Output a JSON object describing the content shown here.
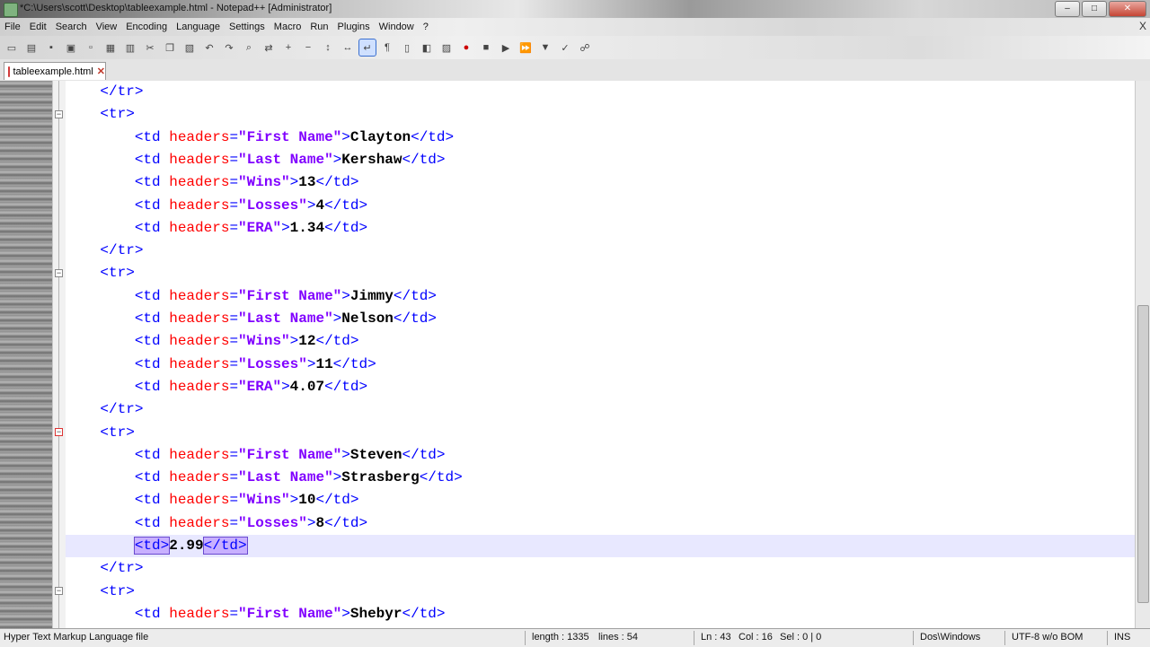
{
  "window": {
    "title": "*C:\\Users\\scott\\Desktop\\tableexample.html - Notepad++ [Administrator]",
    "controls": [
      "–",
      "□",
      "✕"
    ]
  },
  "menubar": {
    "items": [
      "File",
      "Edit",
      "Search",
      "View",
      "Encoding",
      "Language",
      "Settings",
      "Macro",
      "Run",
      "Plugins",
      "Window",
      "?"
    ],
    "close_label": "X"
  },
  "toolbar": {
    "buttons": [
      "new-icon",
      "open-icon",
      "save-icon",
      "save-all-icon",
      "close-icon",
      "close-all-icon",
      "print-icon",
      "cut-icon",
      "copy-icon",
      "paste-icon",
      "undo-icon",
      "redo-icon",
      "find-icon",
      "replace-icon",
      "zoom-in-icon",
      "zoom-out-icon",
      "sync-v-icon",
      "sync-h-icon",
      "wrap-icon",
      "all-chars-icon",
      "indent-guide-icon",
      "udl-icon",
      "doc-map-icon",
      "record-icon",
      "stop-icon",
      "play-icon",
      "play-multi-icon",
      "save-macro-icon",
      "spell-icon",
      "launch-icon"
    ]
  },
  "tabs": [
    {
      "label": "tableexample.html",
      "close": "✕"
    }
  ],
  "editor": {
    "first_line": [
      {
        "t": "    "
      },
      {
        "c": "tag",
        "t": "</tr>"
      }
    ],
    "lines": [
      [
        {
          "t": "    "
        },
        {
          "c": "tag",
          "t": "</tr>"
        }
      ],
      [
        {
          "t": "    "
        },
        {
          "c": "tag",
          "t": "<tr>"
        }
      ],
      [
        {
          "t": "        "
        },
        {
          "c": "tag",
          "t": "<td "
        },
        {
          "c": "attr",
          "t": "headers"
        },
        {
          "c": "tag",
          "t": "="
        },
        {
          "c": "val",
          "t": "\"First Name\""
        },
        {
          "c": "tag",
          "t": ">"
        },
        {
          "c": "txt",
          "t": "Clayton"
        },
        {
          "c": "tag",
          "t": "</td>"
        }
      ],
      [
        {
          "t": "        "
        },
        {
          "c": "tag",
          "t": "<td "
        },
        {
          "c": "attr",
          "t": "headers"
        },
        {
          "c": "tag",
          "t": "="
        },
        {
          "c": "val",
          "t": "\"Last Name\""
        },
        {
          "c": "tag",
          "t": ">"
        },
        {
          "c": "txt",
          "t": "Kershaw"
        },
        {
          "c": "tag",
          "t": "</td>"
        }
      ],
      [
        {
          "t": "        "
        },
        {
          "c": "tag",
          "t": "<td "
        },
        {
          "c": "attr",
          "t": "headers"
        },
        {
          "c": "tag",
          "t": "="
        },
        {
          "c": "val",
          "t": "\"Wins\""
        },
        {
          "c": "tag",
          "t": ">"
        },
        {
          "c": "txt",
          "t": "13"
        },
        {
          "c": "tag",
          "t": "</td>"
        }
      ],
      [
        {
          "t": "        "
        },
        {
          "c": "tag",
          "t": "<td "
        },
        {
          "c": "attr",
          "t": "headers"
        },
        {
          "c": "tag",
          "t": "="
        },
        {
          "c": "val",
          "t": "\"Losses\""
        },
        {
          "c": "tag",
          "t": ">"
        },
        {
          "c": "txt",
          "t": "4"
        },
        {
          "c": "tag",
          "t": "</td>"
        }
      ],
      [
        {
          "t": "        "
        },
        {
          "c": "tag",
          "t": "<td "
        },
        {
          "c": "attr",
          "t": "headers"
        },
        {
          "c": "tag",
          "t": "="
        },
        {
          "c": "val",
          "t": "\"ERA\""
        },
        {
          "c": "tag",
          "t": ">"
        },
        {
          "c": "txt",
          "t": "1.34"
        },
        {
          "c": "tag",
          "t": "</td>"
        }
      ],
      [
        {
          "t": "    "
        },
        {
          "c": "tag",
          "t": "</tr>"
        }
      ],
      [
        {
          "t": "    "
        },
        {
          "c": "tag",
          "t": "<tr>"
        }
      ],
      [
        {
          "t": "        "
        },
        {
          "c": "tag",
          "t": "<td "
        },
        {
          "c": "attr",
          "t": "headers"
        },
        {
          "c": "tag",
          "t": "="
        },
        {
          "c": "val",
          "t": "\"First Name\""
        },
        {
          "c": "tag",
          "t": ">"
        },
        {
          "c": "txt",
          "t": "Jimmy"
        },
        {
          "c": "tag",
          "t": "</td>"
        }
      ],
      [
        {
          "t": "        "
        },
        {
          "c": "tag",
          "t": "<td "
        },
        {
          "c": "attr",
          "t": "headers"
        },
        {
          "c": "tag",
          "t": "="
        },
        {
          "c": "val",
          "t": "\"Last Name\""
        },
        {
          "c": "tag",
          "t": ">"
        },
        {
          "c": "txt",
          "t": "Nelson"
        },
        {
          "c": "tag",
          "t": "</td>"
        }
      ],
      [
        {
          "t": "        "
        },
        {
          "c": "tag",
          "t": "<td "
        },
        {
          "c": "attr",
          "t": "headers"
        },
        {
          "c": "tag",
          "t": "="
        },
        {
          "c": "val",
          "t": "\"Wins\""
        },
        {
          "c": "tag",
          "t": ">"
        },
        {
          "c": "txt",
          "t": "12"
        },
        {
          "c": "tag",
          "t": "</td>"
        }
      ],
      [
        {
          "t": "        "
        },
        {
          "c": "tag",
          "t": "<td "
        },
        {
          "c": "attr",
          "t": "headers"
        },
        {
          "c": "tag",
          "t": "="
        },
        {
          "c": "val",
          "t": "\"Losses\""
        },
        {
          "c": "tag",
          "t": ">"
        },
        {
          "c": "txt",
          "t": "11"
        },
        {
          "c": "tag",
          "t": "</td>"
        }
      ],
      [
        {
          "t": "        "
        },
        {
          "c": "tag",
          "t": "<td "
        },
        {
          "c": "attr",
          "t": "headers"
        },
        {
          "c": "tag",
          "t": "="
        },
        {
          "c": "val",
          "t": "\"ERA\""
        },
        {
          "c": "tag",
          "t": ">"
        },
        {
          "c": "txt",
          "t": "4.07"
        },
        {
          "c": "tag",
          "t": "</td>"
        }
      ],
      [
        {
          "t": "    "
        },
        {
          "c": "tag",
          "t": "</tr>"
        }
      ],
      [
        {
          "t": "    "
        },
        {
          "c": "tag",
          "t": "<tr>"
        }
      ],
      [
        {
          "t": "        "
        },
        {
          "c": "tag",
          "t": "<td "
        },
        {
          "c": "attr",
          "t": "headers"
        },
        {
          "c": "tag",
          "t": "="
        },
        {
          "c": "val",
          "t": "\"First Name\""
        },
        {
          "c": "tag",
          "t": ">"
        },
        {
          "c": "txt",
          "t": "Steven"
        },
        {
          "c": "tag",
          "t": "</td>"
        }
      ],
      [
        {
          "t": "        "
        },
        {
          "c": "tag",
          "t": "<td "
        },
        {
          "c": "attr",
          "t": "headers"
        },
        {
          "c": "tag",
          "t": "="
        },
        {
          "c": "val",
          "t": "\"Last Name\""
        },
        {
          "c": "tag",
          "t": ">"
        },
        {
          "c": "txt",
          "t": "Strasberg"
        },
        {
          "c": "tag",
          "t": "</td>"
        }
      ],
      [
        {
          "t": "        "
        },
        {
          "c": "tag",
          "t": "<td "
        },
        {
          "c": "attr",
          "t": "headers"
        },
        {
          "c": "tag",
          "t": "="
        },
        {
          "c": "val",
          "t": "\"Wins\""
        },
        {
          "c": "tag",
          "t": ">"
        },
        {
          "c": "txt",
          "t": "10"
        },
        {
          "c": "tag",
          "t": "</td>"
        }
      ],
      [
        {
          "t": "        "
        },
        {
          "c": "tag",
          "t": "<td "
        },
        {
          "c": "attr",
          "t": "headers"
        },
        {
          "c": "tag",
          "t": "="
        },
        {
          "c": "val",
          "t": "\"Losses\""
        },
        {
          "c": "tag",
          "t": ">"
        },
        {
          "c": "txt",
          "t": "8"
        },
        {
          "c": "tag",
          "t": "</td>"
        }
      ],
      [
        {
          "t": "        "
        },
        {
          "c": "hl",
          "t": "<td>"
        },
        {
          "c": "txt",
          "t": "2.99"
        },
        {
          "c": "hl",
          "t": "</td>"
        }
      ],
      [
        {
          "t": "    "
        },
        {
          "c": "tag",
          "t": "</tr>"
        }
      ],
      [
        {
          "t": "    "
        },
        {
          "c": "tag",
          "t": "<tr>"
        }
      ],
      [
        {
          "t": "        "
        },
        {
          "c": "tag",
          "t": "<td "
        },
        {
          "c": "attr",
          "t": "headers"
        },
        {
          "c": "tag",
          "t": "="
        },
        {
          "c": "val",
          "t": "\"First Name\""
        },
        {
          "c": "tag",
          "t": ">"
        },
        {
          "c": "txt",
          "t": "Shebyr"
        },
        {
          "c": "tag",
          "t": "</td>"
        }
      ]
    ],
    "current_line_index": 20
  },
  "statusbar": {
    "language": "Hyper Text Markup Language file",
    "length": "length : 1335",
    "lines": "lines : 54",
    "ln": "Ln : 43",
    "col": "Col : 16",
    "sel": "Sel : 0 | 0",
    "eol": "Dos\\Windows",
    "encoding": "UTF-8 w/o BOM",
    "mode": "INS"
  }
}
